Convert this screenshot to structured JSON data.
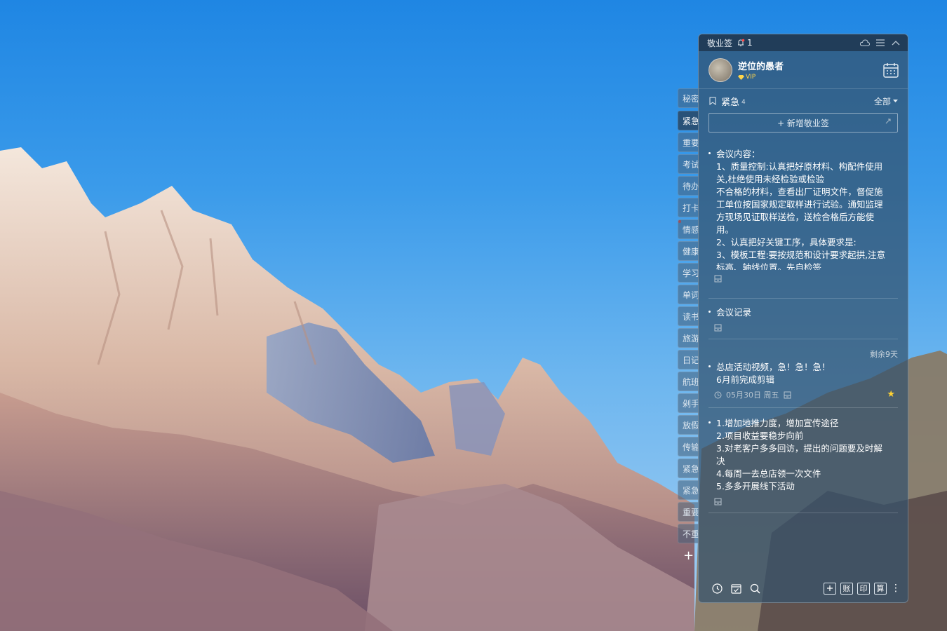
{
  "side_tabs": [
    "秘密",
    "紧急",
    "重要",
    "考试",
    "待办",
    "打卡",
    "情感",
    "健康",
    "学习",
    "单词",
    "读书",
    "旅游",
    "日记",
    "航班",
    "剁手",
    "放假",
    "传输",
    "紧急",
    "紧急",
    "重要",
    "不重"
  ],
  "side_tab_add": "+",
  "window": {
    "title": "敬业签",
    "notification_count": "1"
  },
  "user": {
    "name": "逆位的愚者",
    "badge": "VIP"
  },
  "category": {
    "name": "紧急",
    "count": "4",
    "filter_label": "全部"
  },
  "add_note_label": "+ 新增敬业签",
  "notes": [
    {
      "lines": [
        "会议内容：",
        "1、质量控制:认真把好原材料、构配件使用",
        "关,杜绝使用未经检验或检验",
        "不合格的材料，查看出厂证明文件，督促施",
        "工单位按国家规定取样进行试验。通知监理",
        "方现场见证取样送检，送检合格后方能使",
        "用。",
        "2、认真把好关键工序，具体要求是:",
        "3、模板工程:要按规范和设计要求起拱,注意",
        "标高、轴线位置。先自检签"
      ]
    },
    {
      "lines": [
        "会议记录"
      ]
    },
    {
      "remaining": "剩余9天",
      "lines": [
        "总店活动视频，急！急！急！",
        "6月前完成剪辑"
      ],
      "date": "05月30日 周五"
    },
    {
      "lines": [
        "1.增加地推力度，增加宣传途径",
        "2.项目收益要稳步向前",
        "3.对老客户多多回访，提出的问题要及时解",
        "决",
        "4.每周一去总店领一次文件",
        "5.多多开展线下活动"
      ]
    }
  ],
  "bottom_buttons": [
    "账",
    "印",
    "算"
  ]
}
